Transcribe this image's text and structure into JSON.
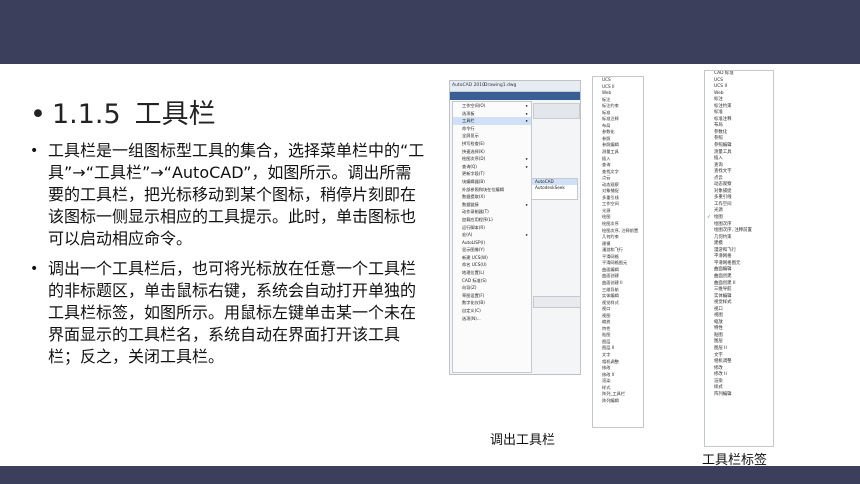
{
  "slide": {
    "heading_bullet": "•",
    "heading_number": "1.1.5",
    "heading_text": "工具栏",
    "bullets": [
      {
        "mark": "•",
        "text": "工具栏是一组图标型工具的集合，选择菜单栏中的“工具”→“工具栏”→“AutoCAD”，如图所示。调出所需要的工具栏，把光标移动到某个图标，稍停片刻即在该图标一侧显示相应的工具提示。此时，单击图标也可以启动相应命令。"
      },
      {
        "mark": "•",
        "text": "调出一个工具栏后，也可将光标放在任意一个工具栏的非标题区，单击鼠标右键，系统会自动打开单独的工具栏标签，如图所示。用鼠标左键单击某一个未在界面显示的工具栏名，系统自动在界面打开该工具栏；反之，关闭工具栏。"
      }
    ],
    "caption_left": "调出工具栏",
    "caption_right": "工具栏标签"
  },
  "acad_window": {
    "title_app": "AutoCAD 2010",
    "title_doc": "Drawing1.dwg",
    "menu_items": [
      "工作空间(O)",
      "选项板",
      "工具栏",
      "命令行",
      "全屏显示",
      "拼写检查(E)",
      "快速选择(K)",
      "绘图次序(D)",
      "查询(Q)",
      "更新字段(T)",
      "块编辑器(B)",
      "外部参照和块在位编辑",
      "数据提取(X)",
      "数据链接",
      "动作录制器(T)",
      "加载应用程序(L)",
      "运行脚本(R)",
      "宏(A)",
      "AutoLISP(I)",
      "显示图像(Y)",
      "新建 UCS(W)",
      "命名 UCS(U)",
      "地理位置(L)",
      "CAD 标准(S)",
      "向导(Z)",
      "草图设置(F)",
      "数字化仪(B)",
      "自定义(C)",
      "选项(N)..."
    ],
    "shortcut_1": "Ctrl+9",
    "shortcut_2": "Ctrl+0",
    "submenu": [
      "AutoCAD",
      "AutodeskSeek"
    ]
  },
  "toolbar_list_left": [
    "UCS",
    "UCS II",
    "Web",
    "标注",
    "标注约束",
    "标准",
    "标准注释",
    "布局",
    "参数化",
    "参照",
    "参照编辑",
    "测量工具",
    "插入",
    "查询",
    "查找文字",
    "点云",
    "动态观察",
    "对象捕捉",
    "多重引线",
    "工作空间",
    "光源",
    "绘图",
    "绘图次序",
    "绘图次序, 注释前置",
    "几何约束",
    "建模",
    "漫游和飞行",
    "平滑网格",
    "平滑网格图元",
    "曲面编辑",
    "曲面创建",
    "曲面创建 II",
    "三维导航",
    "实体编辑",
    "视觉样式",
    "视口",
    "视图",
    "缩放",
    "特性",
    "贴图",
    "图层",
    "图层 II",
    "文字",
    "相机调整",
    "修改",
    "修改 II",
    "渲染",
    "样式",
    "阵列_工具栏",
    "阵列编辑"
  ],
  "toolbar_list_right": [
    "CAD 标准",
    "UCS",
    "UCS II",
    "Web",
    "标注",
    "标注约束",
    "标准",
    "标准注释",
    "布局",
    "参数化",
    "参照",
    "参照编辑",
    "测量工具",
    "插入",
    "查询",
    "查找文字",
    "点云",
    "动态观察",
    "对象捕捉",
    "多重引线",
    "工作空间",
    "光源",
    "绘图",
    "绘图次序",
    "绘图次序, 注释前置",
    "几何约束",
    "建模",
    "漫游和飞行",
    "平滑网格",
    "平滑网格图元",
    "曲面编辑",
    "曲面创建",
    "曲面创建 II",
    "三维导航",
    "实体编辑",
    "视觉样式",
    "视口",
    "视图",
    "缩放",
    "特性",
    "贴图",
    "图层",
    "图层 II",
    "文字",
    "相机调整",
    "修改",
    "修改 II",
    "渲染",
    "样式",
    "阵列编辑"
  ]
}
